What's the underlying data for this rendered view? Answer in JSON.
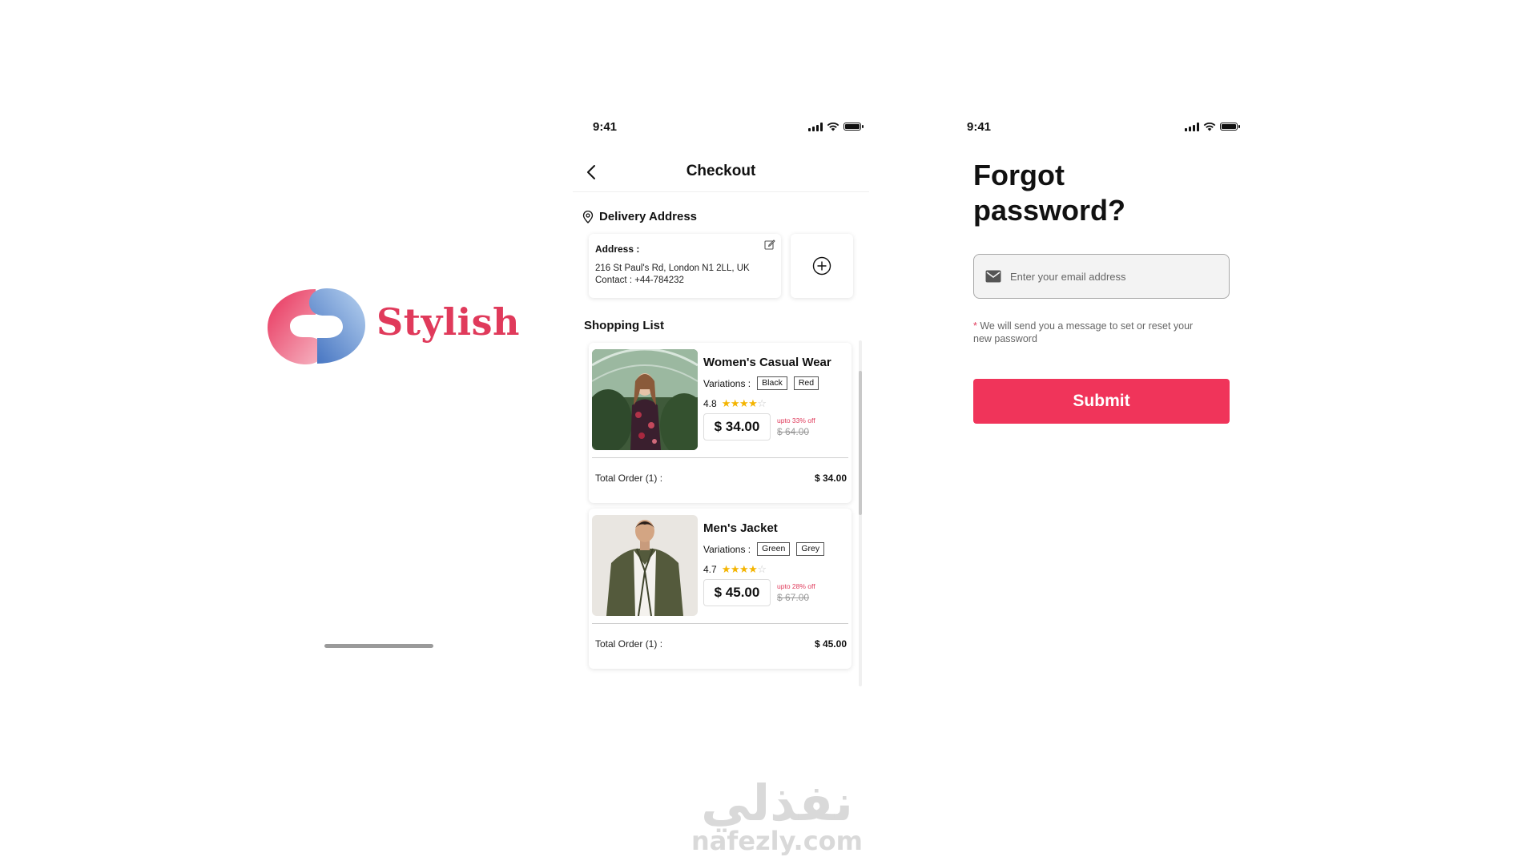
{
  "splash": {
    "brand_name": "Stylish",
    "colors": {
      "brand_pink": "#e03a5b",
      "brand_blue": "#4a7fc9"
    }
  },
  "checkout": {
    "status_time": "9:41",
    "header_title": "Checkout",
    "delivery_title": "Delivery Address",
    "address": {
      "label": "Address :",
      "line": "216 St Paul's Rd, London N1 2LL, UK",
      "contact": "Contact :  +44-784232"
    },
    "shopping_list_title": "Shopping List",
    "products": [
      {
        "name": "Women's Casual Wear",
        "variations_label": "Variations :",
        "variations": [
          "Black",
          "Red"
        ],
        "rating": "4.8",
        "rating_value": 4.8,
        "price": "$ 34.00",
        "discount_note": "upto 33% off",
        "old_price": "$ 64.00",
        "total_label": "Total Order (1)    :",
        "total_value": "$ 34.00"
      },
      {
        "name": "Men's Jacket",
        "variations_label": "Variations :",
        "variations": [
          "Green",
          "Grey"
        ],
        "rating": "4.7",
        "rating_value": 4.7,
        "price": "$ 45.00",
        "discount_note": "upto 28% off",
        "old_price": "$ 67.00",
        "total_label": "Total Order (1)    :",
        "total_value": "$ 45.00"
      }
    ]
  },
  "forgot": {
    "status_time": "9:41",
    "title_line1": "Forgot",
    "title_line2": "password?",
    "email_placeholder": "Enter your email address",
    "note_asterisk": "*",
    "note": " We will send you a message to set or reset your new password",
    "submit_label": "Submit",
    "accent": "#f0345a"
  },
  "watermark": {
    "arabic": "نفذلي",
    "latin": "nafezly.com"
  },
  "icons": [
    "logo-mark",
    "signal-icon",
    "wifi-icon",
    "battery-icon",
    "back-arrow-icon",
    "location-pin-icon",
    "edit-icon",
    "plus-circle-icon",
    "mail-icon",
    "star-icon"
  ]
}
